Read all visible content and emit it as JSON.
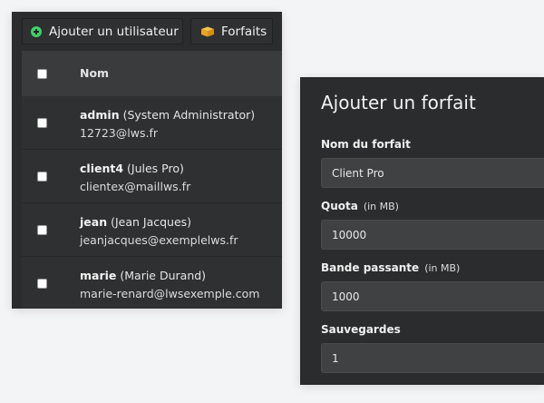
{
  "toolbar": {
    "add_user": "Ajouter un utilisateur",
    "plans": "Forfaits"
  },
  "table": {
    "header": "Nom",
    "rows": [
      {
        "username": "admin",
        "fullname": "(System Administrator)",
        "email": "12723@lws.fr"
      },
      {
        "username": "client4",
        "fullname": "(Jules Pro)",
        "email": "clientex@maillws.fr"
      },
      {
        "username": "jean",
        "fullname": "(Jean Jacques)",
        "email": "jeanjacques@exemplelws.fr"
      },
      {
        "username": "marie",
        "fullname": "(Marie Durand)",
        "email": "marie-renard@lwsexemple.com"
      }
    ]
  },
  "plan_form": {
    "title": "Ajouter un forfait",
    "name_label": "Nom du forfait",
    "name_value": "Client Pro",
    "quota_label": "Quota",
    "quota_unit": "(in MB)",
    "quota_value": "10000",
    "bandwidth_label": "Bande passante",
    "bandwidth_unit": "(in MB)",
    "bandwidth_value": "1000",
    "backups_label": "Sauvegardes",
    "backups_value": "1"
  },
  "colors": {
    "panel_bg": "#2b2c2d",
    "header_bg": "#3a3b3c",
    "add_icon": "#3ad36a",
    "box_icon": "#f0b12a"
  },
  "icons": [
    "plus-circle-icon",
    "box-icon",
    "checkbox"
  ]
}
